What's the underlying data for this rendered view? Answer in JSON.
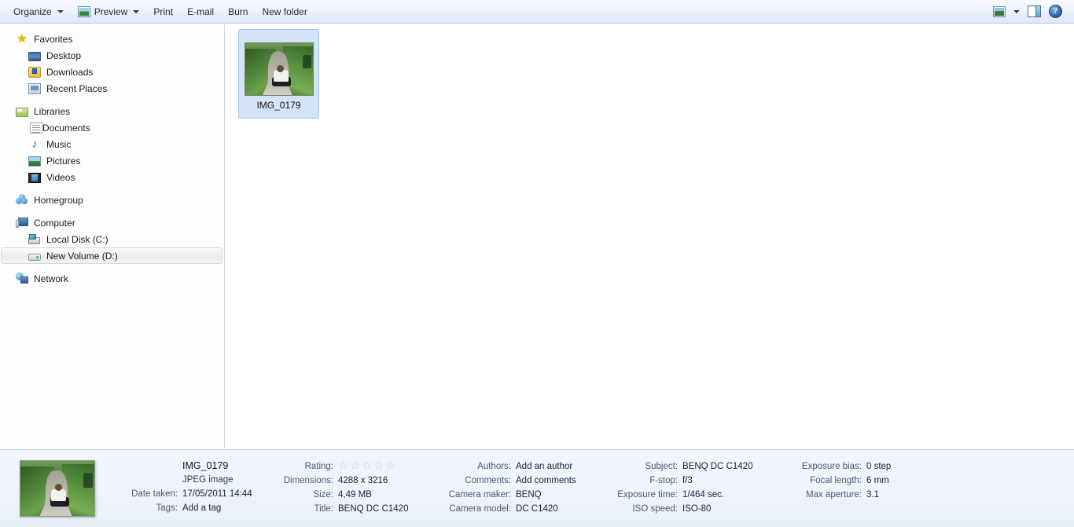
{
  "toolbar": {
    "items": [
      {
        "id": "organize",
        "label": "Organize",
        "icon": null,
        "caret": true
      },
      {
        "id": "preview",
        "label": "Preview",
        "icon": "preview-image-icon",
        "caret": true
      },
      {
        "id": "print",
        "label": "Print",
        "icon": null,
        "caret": false
      },
      {
        "id": "email",
        "label": "E-mail",
        "icon": null,
        "caret": false
      },
      {
        "id": "burn",
        "label": "Burn",
        "icon": null,
        "caret": false
      },
      {
        "id": "new-folder",
        "label": "New folder",
        "icon": null,
        "caret": false
      }
    ],
    "right_icons": [
      {
        "id": "change-view",
        "icon": "view-mode-icon"
      },
      {
        "id": "change-view-caret",
        "icon": "chevron-down-icon"
      },
      {
        "id": "preview-pane",
        "icon": "preview-pane-icon"
      },
      {
        "id": "help",
        "icon": "help-icon",
        "glyph": "?"
      }
    ]
  },
  "sidebar": {
    "groups": [
      {
        "id": "favorites",
        "header": {
          "label": "Favorites",
          "icon": "star-icon"
        },
        "items": [
          {
            "label": "Desktop",
            "icon": "desktop-icon"
          },
          {
            "label": "Downloads",
            "icon": "downloads-icon"
          },
          {
            "label": "Recent Places",
            "icon": "recent-places-icon"
          }
        ]
      },
      {
        "id": "libraries",
        "header": {
          "label": "Libraries",
          "icon": "library-folder-icon"
        },
        "items": [
          {
            "label": "Documents",
            "icon": "document-icon"
          },
          {
            "label": "Music",
            "icon": "music-note-icon"
          },
          {
            "label": "Pictures",
            "icon": "picture-icon"
          },
          {
            "label": "Videos",
            "icon": "video-icon"
          }
        ]
      },
      {
        "id": "homegroup",
        "header": {
          "label": "Homegroup",
          "icon": "homegroup-icon"
        },
        "items": []
      },
      {
        "id": "computer",
        "header": {
          "label": "Computer",
          "icon": "computer-icon"
        },
        "items": [
          {
            "label": "Local Disk (C:)",
            "icon": "hard-disk-icon",
            "selected": false
          },
          {
            "label": "New Volume (D:)",
            "icon": "drive-icon",
            "selected": true
          }
        ]
      },
      {
        "id": "network",
        "header": {
          "label": "Network",
          "icon": "network-icon"
        },
        "items": []
      }
    ]
  },
  "content": {
    "files": [
      {
        "name": "IMG_0179",
        "selected": true,
        "thumbnail": "photo-person-on-path"
      }
    ]
  },
  "details": {
    "preview_thumbnail": "photo-person-on-path",
    "columns": [
      {
        "id": "name-column",
        "rows": [
          {
            "key": "",
            "value": "IMG_0179",
            "style": "title"
          },
          {
            "key": "",
            "value": "JPEG image",
            "style": "subtle"
          },
          {
            "key": "Date taken:",
            "value": "17/05/2011 14:44"
          },
          {
            "key": "Tags:",
            "value": "Add a tag"
          }
        ]
      },
      {
        "id": "column-a",
        "rows": [
          {
            "key": "Rating:",
            "value": "",
            "widget": "stars",
            "stars_filled": 0,
            "stars_total": 5
          },
          {
            "key": "Dimensions:",
            "value": "4288 x 3216"
          },
          {
            "key": "Size:",
            "value": "4,49 MB"
          },
          {
            "key": "Title:",
            "value": "BENQ DC C1420"
          }
        ]
      },
      {
        "id": "column-b",
        "rows": [
          {
            "key": "Authors:",
            "value": "Add an author"
          },
          {
            "key": "Comments:",
            "value": "Add comments"
          },
          {
            "key": "Camera maker:",
            "value": "BENQ"
          },
          {
            "key": "Camera model:",
            "value": "DC C1420"
          }
        ]
      },
      {
        "id": "column-c",
        "rows": [
          {
            "key": "Subject:",
            "value": "BENQ DC C1420"
          },
          {
            "key": "F-stop:",
            "value": "f/3"
          },
          {
            "key": "Exposure time:",
            "value": "1/464 sec."
          },
          {
            "key": "ISO speed:",
            "value": "ISO-80"
          }
        ]
      },
      {
        "id": "column-d",
        "rows": [
          {
            "key": "Exposure bias:",
            "value": "0 step"
          },
          {
            "key": "Focal length:",
            "value": "6 mm"
          },
          {
            "key": "Max aperture:",
            "value": "3.1"
          }
        ]
      }
    ]
  },
  "colors": {
    "toolbar_top": "#f7fbff",
    "toolbar_bottom": "#dfe9f7",
    "selection_blue": "#d4e4f8",
    "selection_border": "#9ec4e8",
    "details_bg": "#eef3fa",
    "key_text": "#4a5a72",
    "value_text": "#16233a"
  }
}
